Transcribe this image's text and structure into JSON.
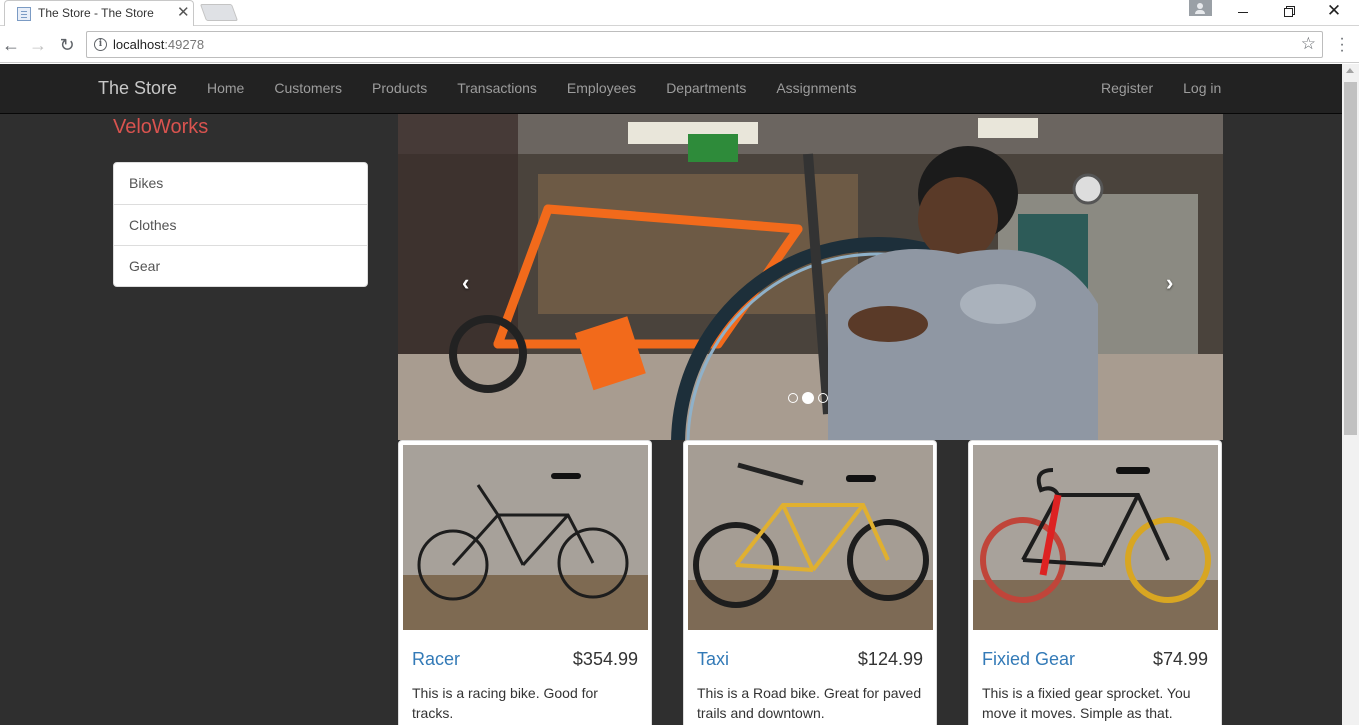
{
  "browser": {
    "tab_title": "The Store - The Store",
    "tab_close": "✕",
    "url_host": "localhost",
    "url_port": ":49278",
    "icons": [
      "page-icon",
      "close-icon",
      "user-icon",
      "minimize-icon",
      "maximize-icon",
      "close-icon",
      "back-arrow-icon",
      "forward-arrow-icon",
      "reload-icon",
      "info-icon",
      "star-icon",
      "menu-icon"
    ]
  },
  "navbar": {
    "brand": "The Store",
    "links": [
      "Home",
      "Customers",
      "Products",
      "Transactions",
      "Employees",
      "Departments",
      "Assignments"
    ],
    "right_links": [
      "Register",
      "Log in"
    ]
  },
  "sidebar": {
    "title": "VeloWorks",
    "categories": [
      "Bikes",
      "Clothes",
      "Gear"
    ]
  },
  "carousel": {
    "prev": "‹",
    "next": "›",
    "slide_count": 3,
    "active_slide": 2
  },
  "products": [
    {
      "name": "Racer",
      "price": "$354.99",
      "description": "This is a racing bike. Good for tracks."
    },
    {
      "name": "Taxi",
      "price": "$124.99",
      "description": "This is a Road bike. Great for paved trails and downtown."
    },
    {
      "name": "Fixied Gear",
      "price": "$74.99",
      "description": "This is a fixied gear sprocket. You move it moves. Simple as that."
    }
  ],
  "colors": {
    "page_bg": "#2f2f2f",
    "navbar_bg": "#222222",
    "brand_red": "#d9534f",
    "link_blue": "#337ab7"
  }
}
